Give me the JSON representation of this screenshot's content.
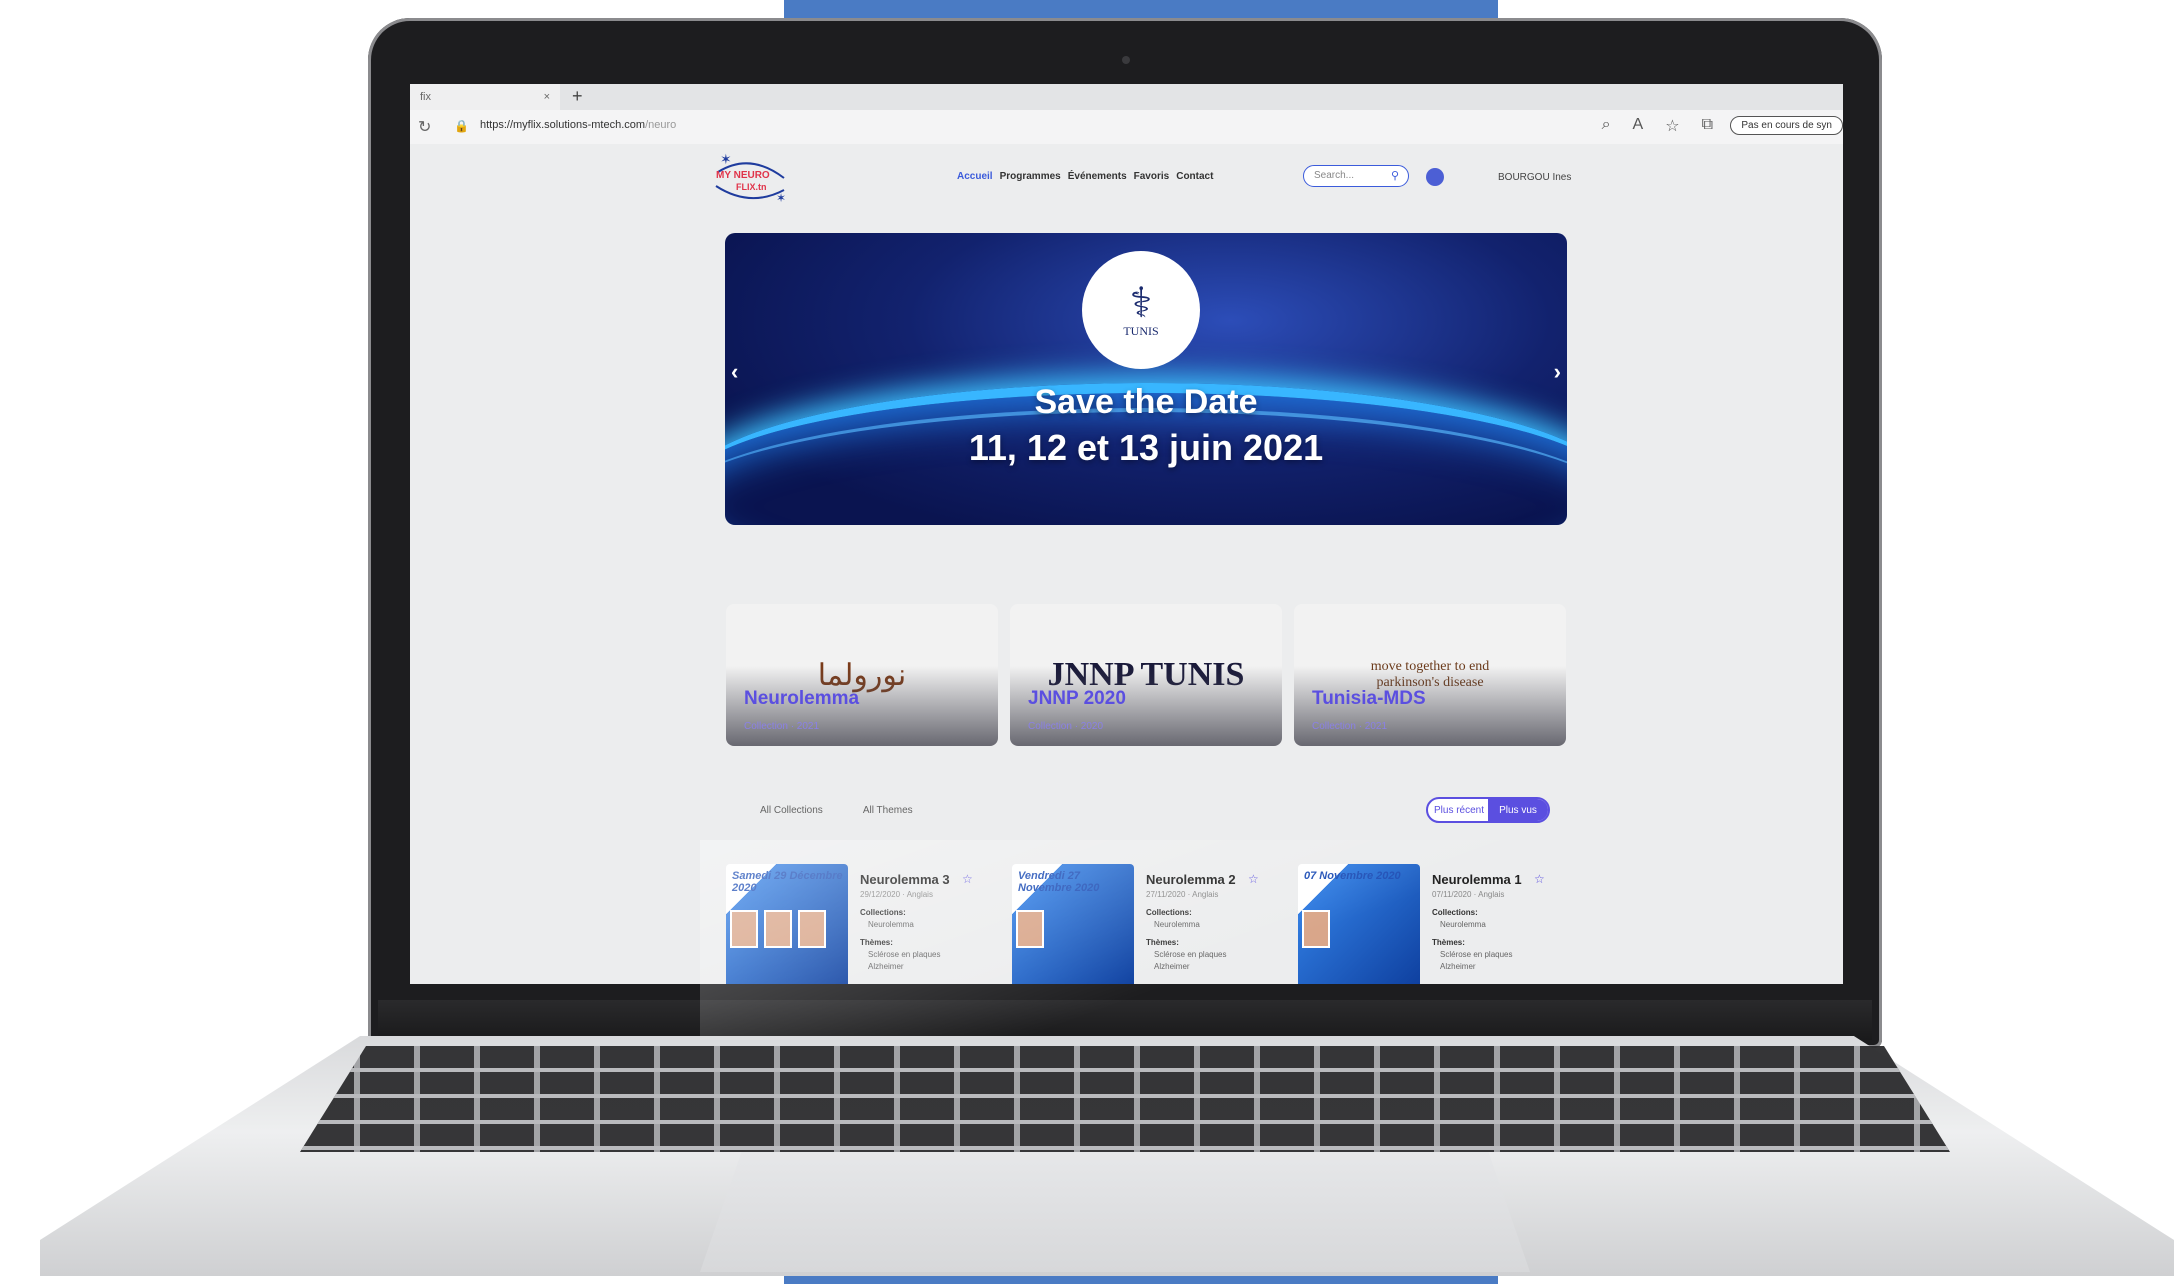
{
  "browser": {
    "tab_title": "fix",
    "tab_close": "×",
    "new_tab": "+",
    "url_host": "https://myflix.solutions-mtech.com",
    "url_path": "/neuro",
    "sync_label": "Pas en cours de syn"
  },
  "site": {
    "logo_text_1": "MY NEURO",
    "logo_text_2": "FLIX.tn",
    "nav": [
      "Accueil",
      "Programmes",
      "Événements",
      "Favoris",
      "Contact"
    ],
    "search_placeholder": "Search...",
    "user_name": "BOURGOU Ines",
    "accent_color": "#5b4fe0"
  },
  "hero": {
    "badge_label": "TUNIS",
    "title": "Save the Date",
    "date": "11, 12 et 13 juin 2021"
  },
  "collections": [
    {
      "title": "Neurolemma",
      "sub": "Collection · 2021",
      "art_text": "نورولما"
    },
    {
      "title": "JNNP 2020",
      "sub": "Collection · 2020",
      "art_text": "JNNP TUNIS"
    },
    {
      "title": "Tunisia-MDS",
      "sub": "Collection · 2021",
      "art_text": "move together to end parkinson's disease"
    }
  ],
  "filters": {
    "all_collections": "All Collections",
    "all_themes": "All Themes",
    "sort_recent": "Plus récent",
    "sort_popular": "Plus vus"
  },
  "episodes": [
    {
      "date": "Samedi 29 Décembre 2020",
      "name": "Neurolemma 3",
      "meta": "29/12/2020 · Anglais",
      "collections_label": "Collections:",
      "collection": "Neurolemma",
      "themes_label": "Thèmes:",
      "theme1": "Sclérose en plaques",
      "theme2": "Alzheimer"
    },
    {
      "date": "Vendredi 27 Novembre 2020",
      "name": "Neurolemma 2",
      "meta": "27/11/2020 · Anglais",
      "collections_label": "Collections:",
      "collection": "Neurolemma",
      "themes_label": "Thèmes:",
      "theme1": "Sclérose en plaques",
      "theme2": "Alzheimer"
    },
    {
      "date": "07 Novembre 2020",
      "name": "Neurolemma 1",
      "meta": "07/11/2020 · Anglais",
      "collections_label": "Collections:",
      "collection": "Neurolemma",
      "themes_label": "Thèmes:",
      "theme1": "Sclérose en plaques",
      "theme2": "Alzheimer"
    }
  ]
}
